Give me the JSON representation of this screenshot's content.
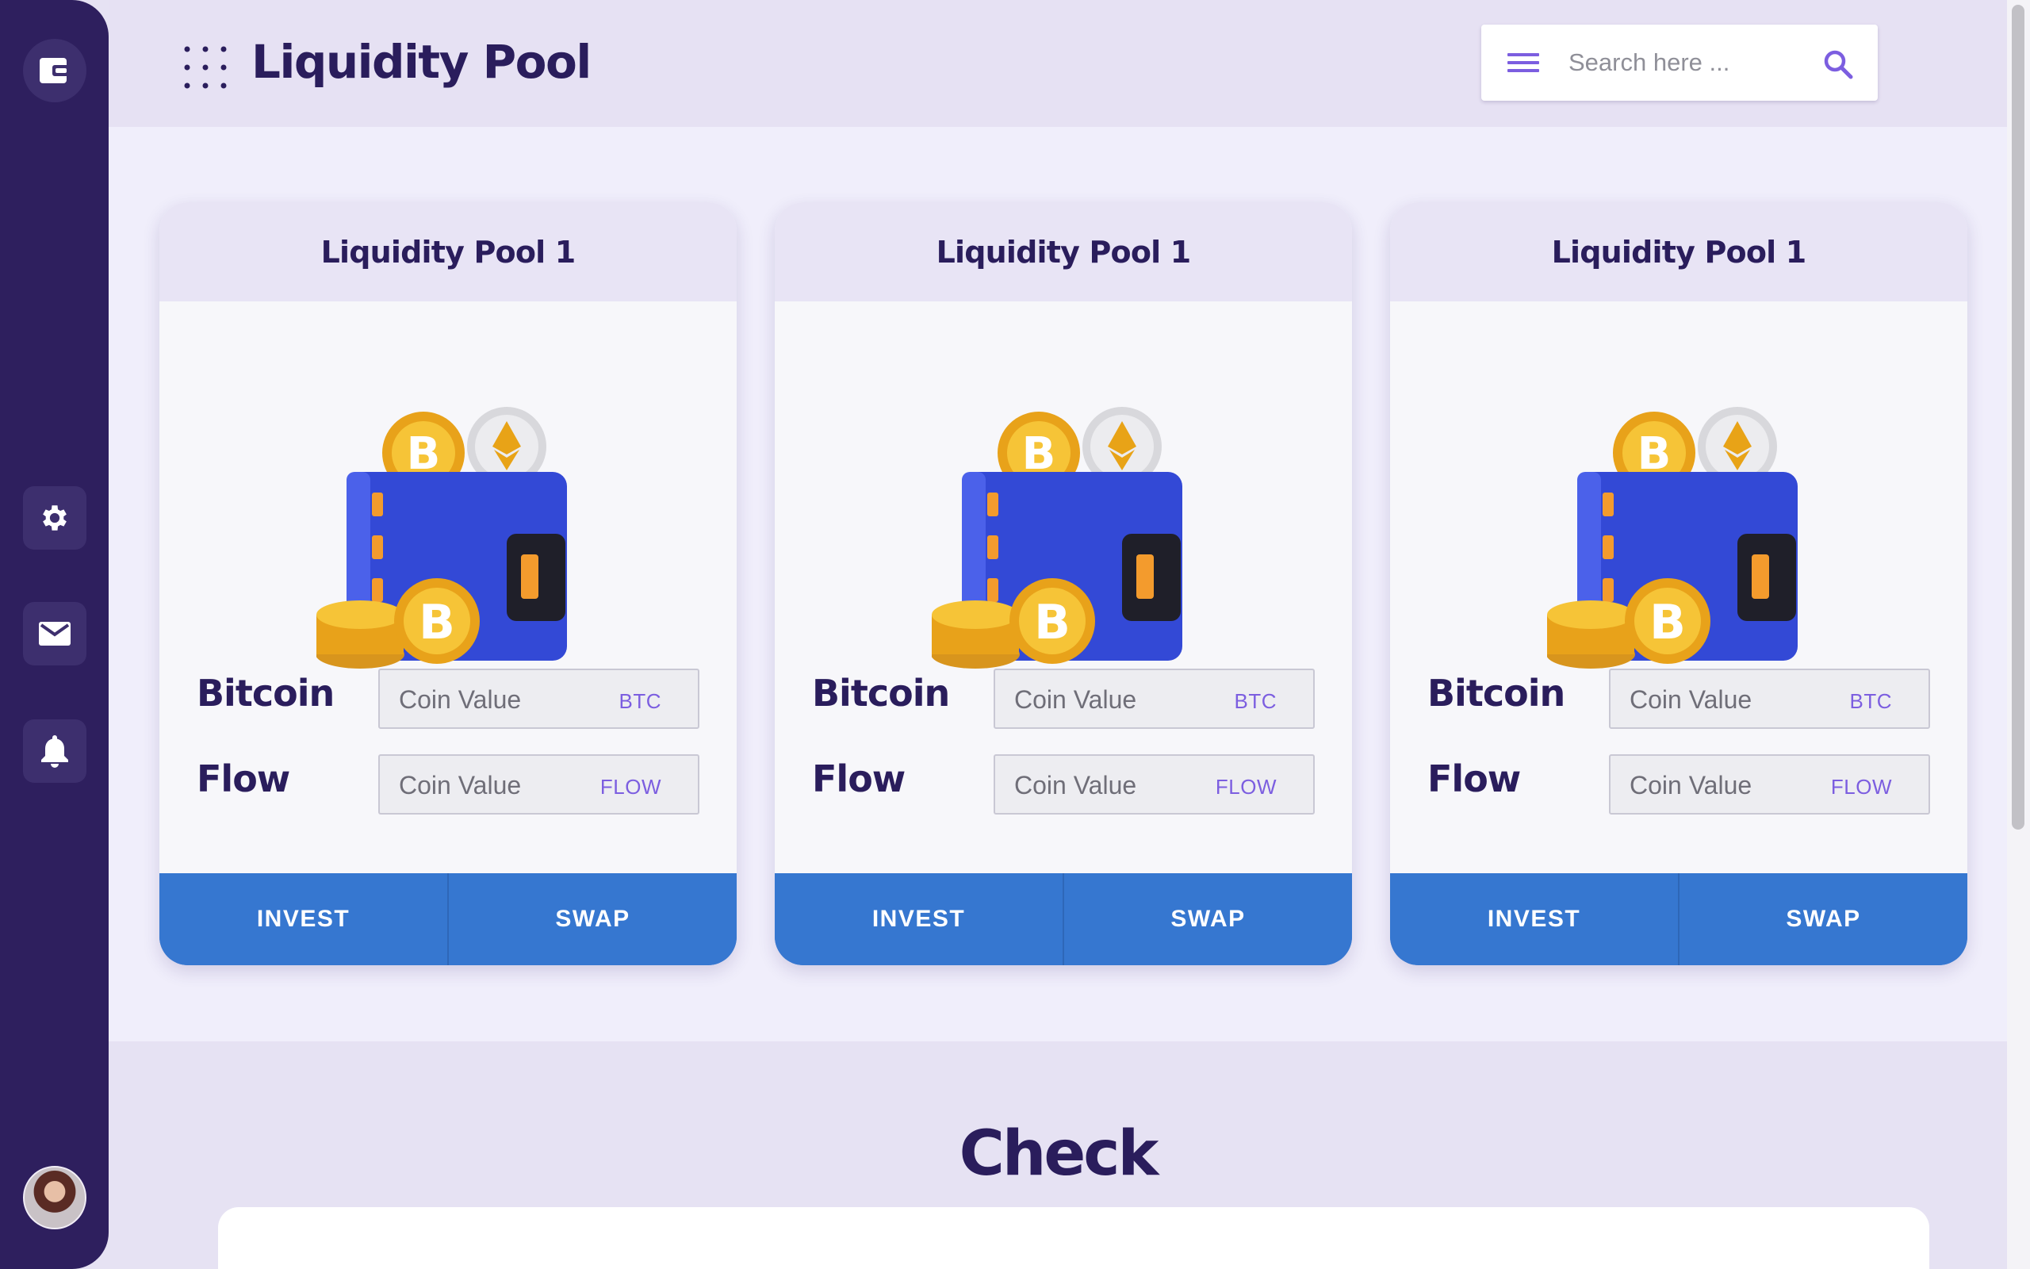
{
  "header": {
    "title": "Liquidity Pool",
    "search_placeholder": "Search here ..."
  },
  "sidebar": {
    "items": [
      "wallet-icon",
      "gear-icon",
      "mail-icon",
      "bell-icon"
    ]
  },
  "cards": [
    {
      "title": "Liquidity Pool 1",
      "rows": [
        {
          "label": "Bitcoin",
          "placeholder": "Coin Value",
          "unit": "BTC"
        },
        {
          "label": "Flow",
          "placeholder": "Coin Value",
          "unit": "FLOW"
        }
      ],
      "actions": [
        "INVEST",
        "SWAP"
      ]
    },
    {
      "title": "Liquidity Pool 1",
      "rows": [
        {
          "label": "Bitcoin",
          "placeholder": "Coin Value",
          "unit": "BTC"
        },
        {
          "label": "Flow",
          "placeholder": "Coin Value",
          "unit": "FLOW"
        }
      ],
      "actions": [
        "INVEST",
        "SWAP"
      ]
    },
    {
      "title": "Liquidity Pool 1",
      "rows": [
        {
          "label": "Bitcoin",
          "placeholder": "Coin Value",
          "unit": "BTC"
        },
        {
          "label": "Flow",
          "placeholder": "Coin Value",
          "unit": "FLOW"
        }
      ],
      "actions": [
        "INVEST",
        "SWAP"
      ]
    }
  ],
  "check": {
    "title": "Check"
  },
  "colors": {
    "sidebar": "#2e1f5e",
    "accent": "#7c5ee0",
    "button": "#3677d0",
    "title_text": "#2a1d5c"
  }
}
